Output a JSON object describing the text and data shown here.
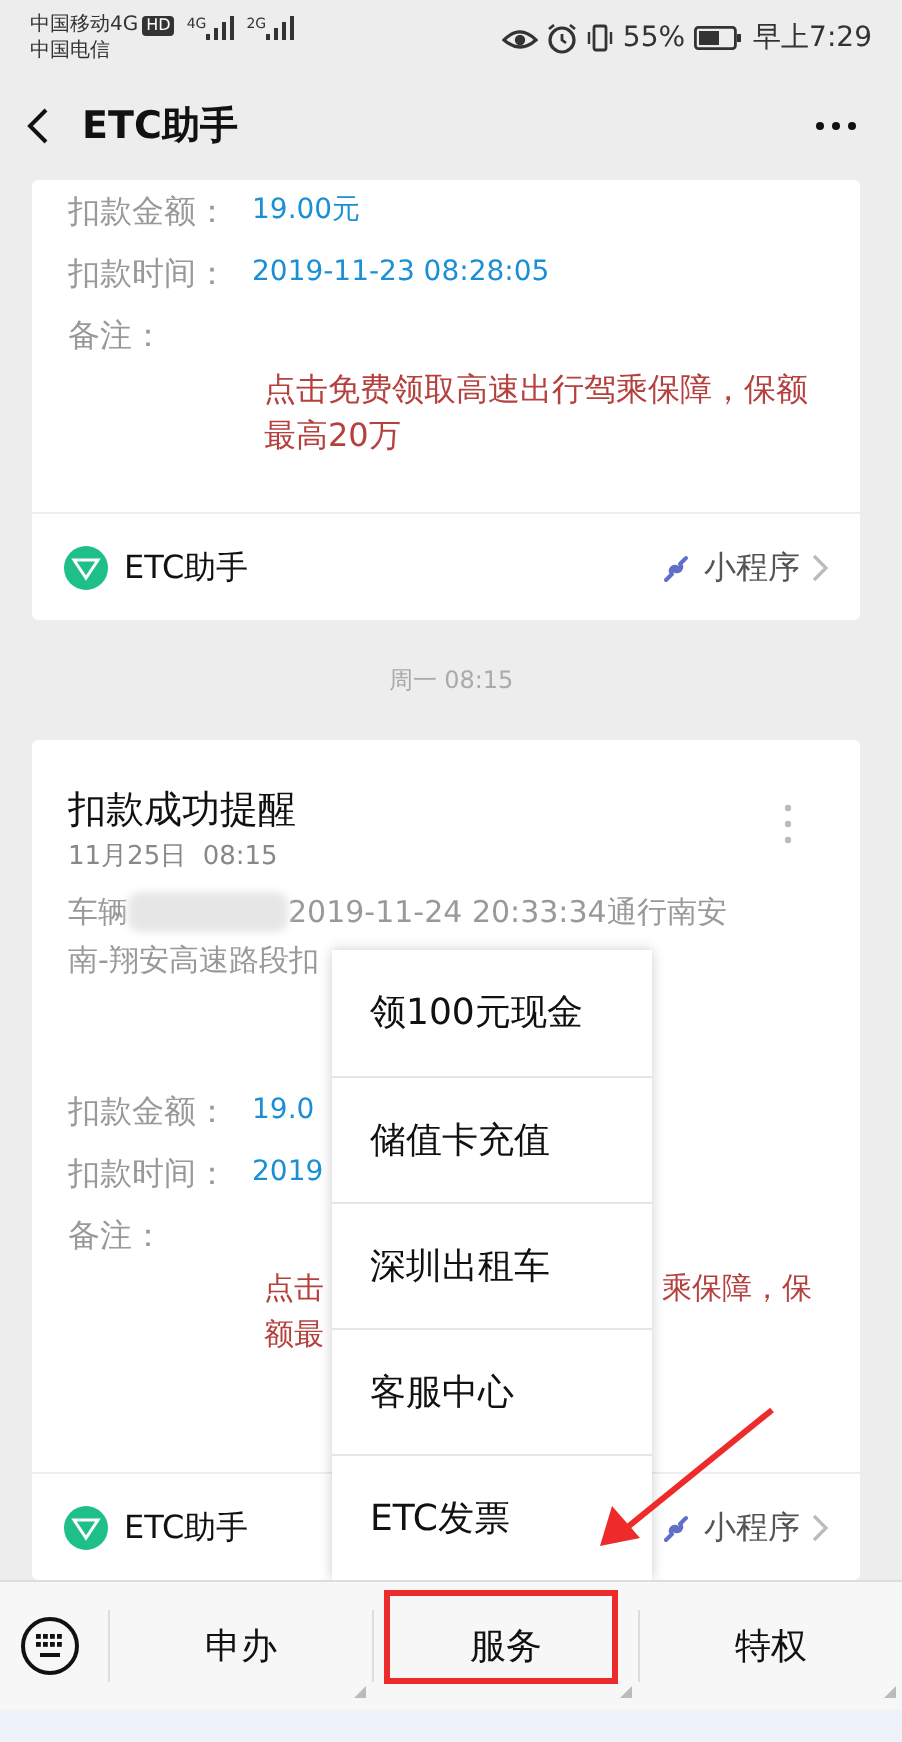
{
  "status_bar": {
    "carrier_1": "中国移动4G",
    "hd": "HD",
    "carrier_2": "中国电信",
    "network_1": "4G",
    "network_2": "2G",
    "battery": "55%",
    "time": "早上7:29"
  },
  "nav": {
    "title": "ETC助手"
  },
  "cards": [
    {
      "fields": [
        {
          "label": "扣款金额：",
          "value": "19.00元"
        },
        {
          "label": "扣款时间：",
          "value": "2019-11-23 08:28:05"
        },
        {
          "label": "备注："
        }
      ],
      "remark": "点击免费领取高速出行驾乘保障，保额最高20万",
      "footer": {
        "name": "ETC助手",
        "tag": "小程序"
      }
    },
    {
      "timestamp": "周一 08:15",
      "title": "扣款成功提醒",
      "date": "11月25日  08:15",
      "body_start": "车辆",
      "body_end": "2019-11-24 20:33:34通行南安",
      "body_line_2": "南-翔安高速路段扣",
      "fields": [
        {
          "label": "扣款金额：",
          "value": "19.0"
        },
        {
          "label": "扣款时间：",
          "value": "2019"
        },
        {
          "label": "备注："
        }
      ],
      "remark_lines": [
        {
          "left": "点击",
          "right": "乘保障，保"
        },
        {
          "left": "额最"
        }
      ],
      "footer": {
        "name": "ETC助手",
        "tag": "小程序"
      }
    }
  ],
  "menu": {
    "items": [
      "领100元现金",
      "储值卡充值",
      "深圳出租车",
      "客服中心",
      "ETC发票"
    ]
  },
  "bottom_tabs": [
    "申办",
    "服务",
    "特权"
  ]
}
